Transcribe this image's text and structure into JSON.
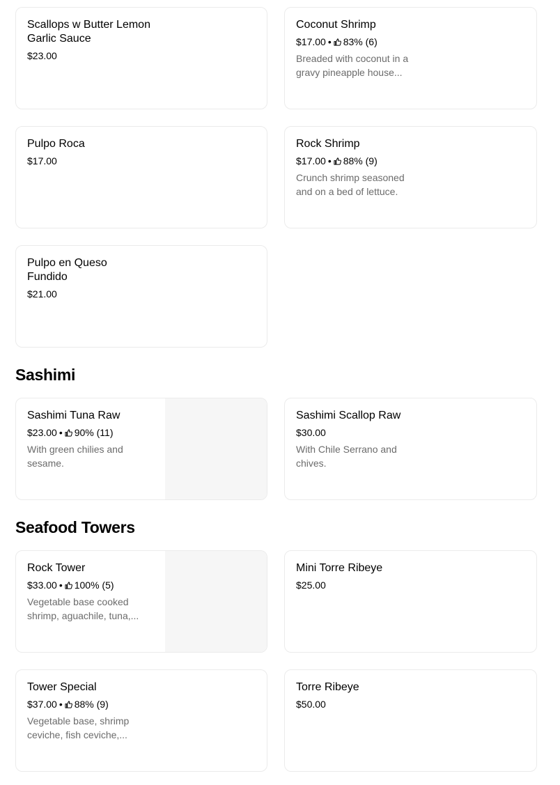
{
  "items_top": [
    {
      "name": "Scallops w Butter Lemon Garlic Sauce",
      "price": "$23.00"
    },
    {
      "name": "Coconut Shrimp",
      "price": "$17.00",
      "rating": "83% (6)",
      "description": "Breaded with coconut in a gravy pineapple house..."
    },
    {
      "name": "Pulpo Roca",
      "price": "$17.00"
    },
    {
      "name": "Rock Shrimp",
      "price": "$17.00",
      "rating": "88% (9)",
      "description": "Crunch shrimp seasoned and on a bed of lettuce."
    },
    {
      "name": "Pulpo en Queso Fundido",
      "price": "$21.00"
    }
  ],
  "sections": [
    {
      "title": "Sashimi",
      "items": [
        {
          "name": "Sashimi Tuna Raw",
          "price": "$23.00",
          "rating": "90% (11)",
          "description": "With green chilies and sesame."
        },
        {
          "name": "Sashimi Scallop Raw",
          "price": "$30.00",
          "description": "With Chile Serrano and chives."
        }
      ]
    },
    {
      "title": "Seafood Towers",
      "items": [
        {
          "name": "Rock Tower",
          "price": "$33.00",
          "rating": "100% (5)",
          "description": "Vegetable base cooked shrimp, aguachile, tuna,..."
        },
        {
          "name": "Mini Torre Ribeye",
          "price": "$25.00"
        },
        {
          "name": "Tower Special",
          "price": "$37.00",
          "rating": "88% (9)",
          "description": "Vegetable base, shrimp ceviche, fish ceviche,..."
        },
        {
          "name": "Torre Ribeye",
          "price": "$50.00"
        }
      ]
    }
  ],
  "separator": "•",
  "icons": {
    "rating": "thumbs-up-icon"
  }
}
